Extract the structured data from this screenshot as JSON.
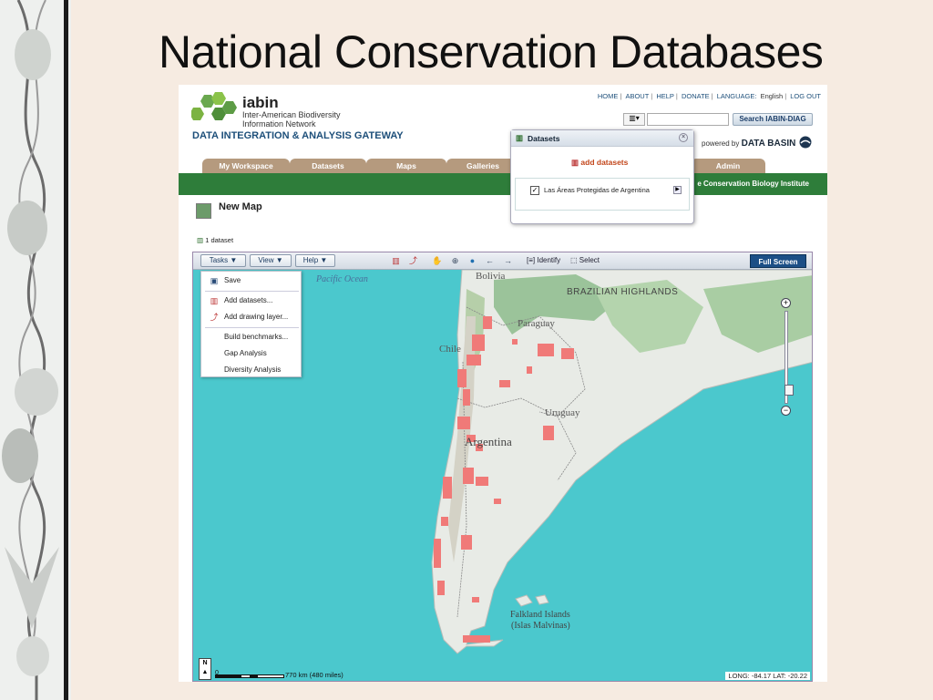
{
  "slide": {
    "title": "National Conservation Databases"
  },
  "header": {
    "logo_name": "iabin",
    "logo_sub": "Inter-American Biodiversity Information Network",
    "gateway": "DATA INTEGRATION & ANALYSIS GATEWAY",
    "links": {
      "home": "HOME",
      "about": "ABOUT",
      "help": "HELP",
      "donate": "DONATE",
      "language_label": "LANGUAGE:",
      "language_value": "English",
      "logout": "LOG OUT"
    },
    "search": {
      "button": "Search IABIN-DIAG",
      "value": ""
    },
    "powered_by": "powered by",
    "brand": "DATA BASIN"
  },
  "nav": {
    "tabs": [
      "My Workspace",
      "Datasets",
      "Maps",
      "Galleries",
      "Admin"
    ],
    "banner": "e Conservation Biology Institute"
  },
  "page": {
    "title": "New Map",
    "dataset_count": "1 dataset"
  },
  "datasets_popup": {
    "title": "Datasets",
    "add_label": "add datasets",
    "item_label": "Las Áreas Protegidas de Argentina",
    "checkbox": "✓"
  },
  "toolbar": {
    "tasks": "Tasks",
    "view": "View",
    "help": "Help",
    "identify": "Identify",
    "select": "Select",
    "fullscreen": "Full Screen"
  },
  "task_menu": {
    "save": "Save",
    "add_datasets": "Add datasets...",
    "add_drawing": "Add drawing layer...",
    "build_benchmarks": "Build benchmarks...",
    "gap_analysis": "Gap Analysis",
    "diversity_analysis": "Diversity Analysis"
  },
  "map": {
    "labels": {
      "pacific": "Pacific Ocean",
      "bolivia": "Bolivia",
      "brazilian": "BRAZILIAN HIGHLANDS",
      "paraguay": "Paraguay",
      "chile": "Chile",
      "uruguay": "Uruguay",
      "argentina": "Argentina",
      "falkland": "Falkland Islands",
      "malvinas": "(Islas Malvinas)"
    },
    "north": "N",
    "scale_zero": "0",
    "scale_text": "770 km (480 miles)",
    "coords": "LONG: -84.17 LAT: -20.22",
    "colors": {
      "ocean": "#4bc8cd",
      "land": "#e8ebe6",
      "protected": "#f07a78",
      "forest": "#9bc39a"
    }
  }
}
